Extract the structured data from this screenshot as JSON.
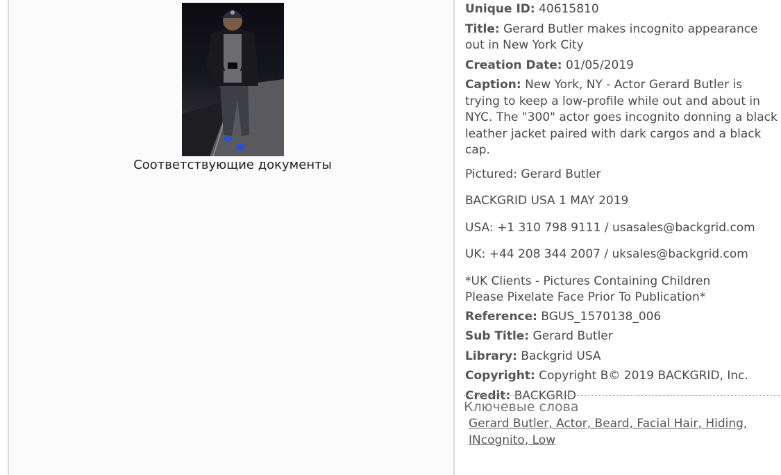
{
  "left": {
    "photo_alt": "Gerard Butler",
    "related_documents": "Соответствующие документы"
  },
  "details": {
    "unique_id": {
      "label": "Unique ID:",
      "value": "40615810"
    },
    "title": {
      "label": "Title:",
      "value": "Gerard Butler makes incognito appearance out in New York City"
    },
    "creation_date": {
      "label": "Creation Date:",
      "value": "01/05/2019"
    },
    "caption": {
      "label": "Caption:",
      "value": "New York, NY - Actor Gerard Butler is trying to keep a low-profile while out and about in NYC. The \"300\" actor goes incognito donning a black leather jacket paired with dark cargos and a black cap."
    },
    "pictured": "Pictured: Gerard Butler",
    "backgrid_line": "BACKGRID USA 1 MAY 2019",
    "usa_contact": "USA: +1 310 798 9111 / usasales@backgrid.com",
    "uk_contact": "UK: +44 208 344 2007 / uksales@backgrid.com",
    "uk_clients_line1": "*UK Clients - Pictures Containing Children",
    "uk_clients_line2": "Please Pixelate Face Prior To Publication*",
    "reference": {
      "label": "Reference:",
      "value": "BGUS_1570138_006"
    },
    "sub_title": {
      "label": "Sub Title:",
      "value": "Gerard Butler"
    },
    "library": {
      "label": "Library:",
      "value": "Backgrid USA"
    },
    "copyright": {
      "label": "Copyright:",
      "value": "Copyright B© 2019 BACKGRID, Inc."
    },
    "credit": {
      "label": "Credit:",
      "value": "BACKGRID"
    }
  },
  "keywords": {
    "heading": "Ключевые слова",
    "text": "Gerard Butler, Actor, Beard, Facial Hair, Hiding, INcognito, Low"
  }
}
